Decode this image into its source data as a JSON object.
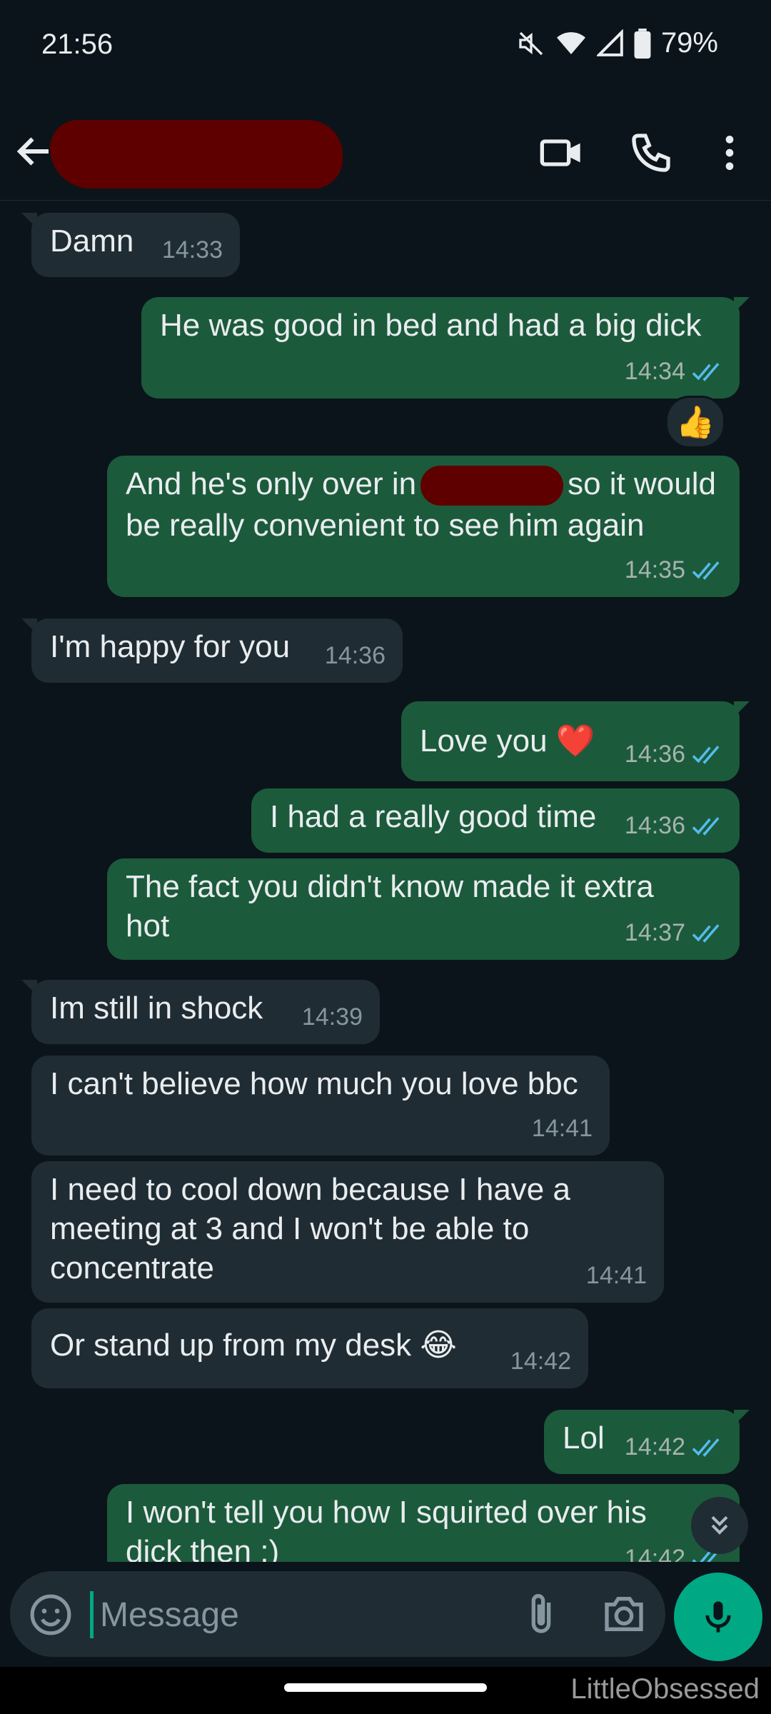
{
  "status_bar": {
    "time": "21:56",
    "battery": "79%"
  },
  "header": {
    "icons": [
      "back-arrow-icon",
      "video-call-icon",
      "voice-call-icon",
      "more-options-icon"
    ]
  },
  "messages": [
    {
      "dir": "in",
      "text": "Damn",
      "time": "14:33"
    },
    {
      "dir": "out",
      "text": "He was good in bed and had a big dick",
      "time": "14:34",
      "reaction": "👍"
    },
    {
      "dir": "out",
      "text_before": "And he's only over in",
      "text_after": "so it would be really convenient to see him again",
      "time": "14:35"
    },
    {
      "dir": "in",
      "text": "I'm happy for you",
      "time": "14:36"
    },
    {
      "dir": "out",
      "text": "Love you ❤️",
      "time": "14:36"
    },
    {
      "dir": "out",
      "text": "I had a really good time",
      "time": "14:36"
    },
    {
      "dir": "out",
      "text": "The fact you didn't know made it extra hot",
      "time": "14:37"
    },
    {
      "dir": "in",
      "text": "Im still in shock",
      "time": "14:39"
    },
    {
      "dir": "in",
      "text": "I can't believe how much you love bbc",
      "time": "14:41"
    },
    {
      "dir": "in",
      "text": "I need to cool down because I have a meeting at 3 and I won't be able to concentrate",
      "time": "14:41"
    },
    {
      "dir": "in",
      "text": "Or stand up from my desk 😂",
      "time": "14:42"
    },
    {
      "dir": "out",
      "text": "Lol",
      "time": "14:42"
    },
    {
      "dir": "out",
      "text": "I won't tell you how I squirted over his dick then :)",
      "time": "14:42"
    }
  ],
  "input": {
    "placeholder": "Message"
  },
  "colors": {
    "background": "#0b141a",
    "incoming_bubble": "#202c33",
    "outgoing_bubble": "#1c5a3c",
    "accent": "#00a884",
    "read_ticks": "#53bdeb"
  },
  "watermark": "LittleObsessed"
}
